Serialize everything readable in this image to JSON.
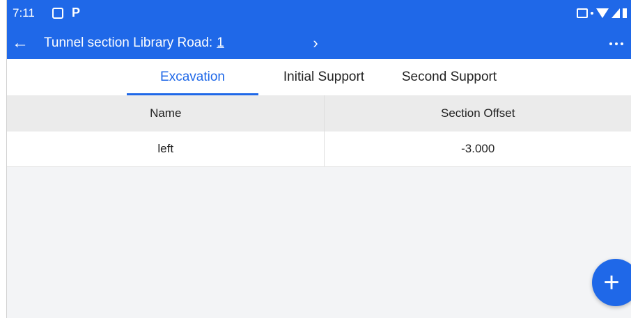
{
  "status_bar": {
    "time": "7:11",
    "left_icons": [
      "gallery-icon",
      "p-icon"
    ],
    "p_glyph": "P",
    "right_icons": [
      "cast-icon",
      "data-dot-icon",
      "wifi-icon",
      "signal-icon",
      "battery-icon"
    ]
  },
  "app_bar": {
    "back_icon": "←",
    "title": "Tunnel section Library Road:",
    "title_number": "1",
    "next_icon": "›",
    "more_icon": "more-dots-icon"
  },
  "tabs": [
    {
      "label": "Excavation",
      "active": true
    },
    {
      "label": "Initial Support",
      "active": false
    },
    {
      "label": "Second Support",
      "active": false
    }
  ],
  "table": {
    "columns": [
      "Name",
      "Section Offset"
    ],
    "rows": [
      [
        "left",
        "-3.000"
      ]
    ]
  },
  "fab": {
    "label": "+",
    "icon": "plus-icon"
  },
  "colors": {
    "primary": "#1f68e8",
    "background": "#f3f4f6",
    "header_row": "#ebebeb"
  }
}
